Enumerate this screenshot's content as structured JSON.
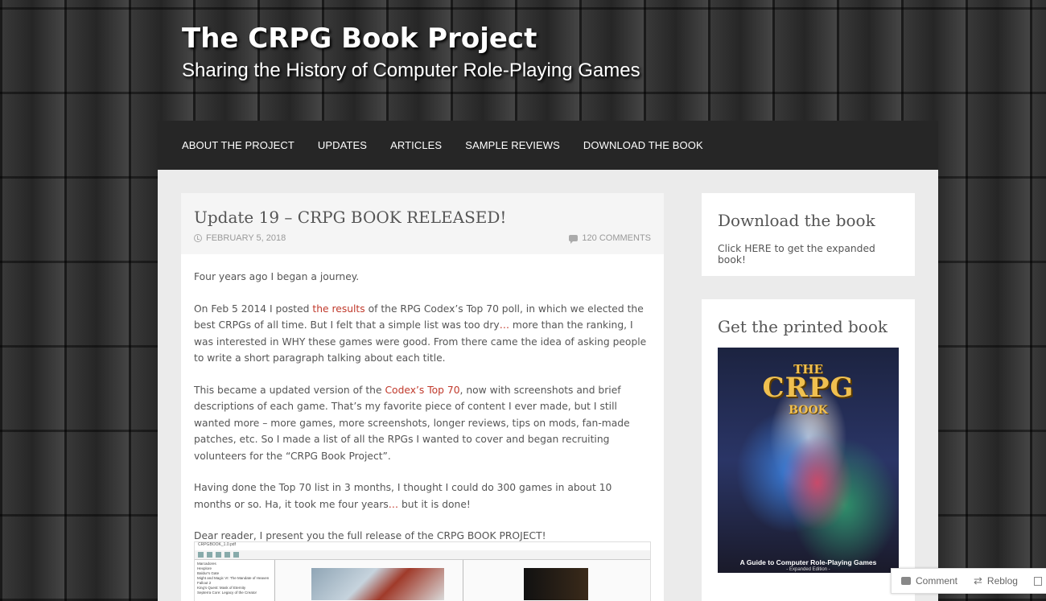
{
  "site": {
    "title": "The CRPG Book Project",
    "tagline": "Sharing the History of Computer Role-Playing Games"
  },
  "nav": {
    "items": [
      "ABOUT THE PROJECT",
      "UPDATES",
      "ARTICLES",
      "SAMPLE REVIEWS",
      "DOWNLOAD THE BOOK"
    ]
  },
  "post": {
    "title": "Update 19 – CRPG BOOK RELEASED!",
    "date": "FEBRUARY 5, 2018",
    "comments": "120 COMMENTS",
    "p1": "Four years ago I began a journey.",
    "p2_a": "On Feb 5 2014 I posted ",
    "p2_link": "the results",
    "p2_b": " of the RPG Codex’s Top 70 poll, in which we elected the best CRPGs of all time. But I felt that a simple list was too dry",
    "p2_ellipsis": "…",
    "p2_c": " more than the ranking, I was interested in WHY these games were good. From there came the idea of asking people to write a short paragraph talking about each title.",
    "p3_a": "This became a updated version of the ",
    "p3_link": "Codex’s Top 70",
    "p3_b": ", now with screenshots and brief descriptions of each game. That’s my favorite piece of content I ever made, but I still wanted more – more games, more screenshots, longer reviews, tips on mods, fan-made patches, etc. So I made a list of all the RPGs I wanted to cover and began recruiting volunteers for the “CRPG Book Project”.",
    "p4_a": "Having done the Top 70 list in 3 months, I thought I could do 300 games in about 10 months or so. Ha, it took me four years",
    "p4_ellipsis": "…",
    "p4_b": " but it is done!",
    "p5": "Dear reader, I present you the full release of the CRPG BOOK PROJECT!"
  },
  "screenshot": {
    "filename": "CRPGBOOK_1.0.pdf",
    "sidebar_items": [
      "Marcadores",
      "Hexplore",
      "Baldur's Gate",
      "Might and Magic VI: The Mandate of Heaven",
      "Fallout 2",
      "King's Quest: Mask of Eternity",
      "Septerra Core: Legacy of the Creator"
    ]
  },
  "widgets": {
    "download": {
      "title": "Download the book",
      "text": "Click HERE to get the expanded book!"
    },
    "printed": {
      "title": "Get the printed book",
      "cover_the": "THE",
      "cover_crpg": "CRPG",
      "cover_book": "BOOK",
      "cover_subtitle": "A Guide to Computer Role-Playing Games",
      "cover_edition": "- Expanded Edition -"
    }
  },
  "actions": {
    "comment": "Comment",
    "reblog": "Reblog"
  }
}
